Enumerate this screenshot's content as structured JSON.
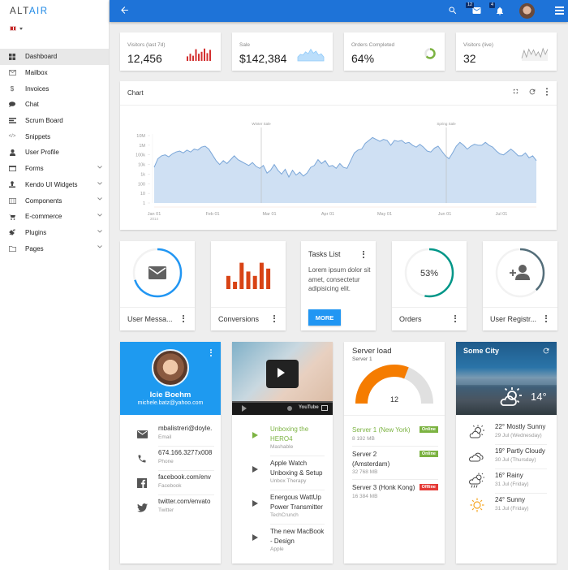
{
  "app": {
    "logo_dark": "ALT",
    "logo_accent": "AIR",
    "language": "en-gb"
  },
  "sidebar": {
    "items": [
      {
        "label": "Dashboard",
        "icon": "dashboard-icon",
        "active": true,
        "expandable": false
      },
      {
        "label": "Mailbox",
        "icon": "mail-icon",
        "active": false,
        "expandable": false
      },
      {
        "label": "Invoices",
        "icon": "dollar-icon",
        "active": false,
        "expandable": false
      },
      {
        "label": "Chat",
        "icon": "chat-icon",
        "active": false,
        "expandable": false
      },
      {
        "label": "Scrum Board",
        "icon": "board-icon",
        "active": false,
        "expandable": false
      },
      {
        "label": "Snippets",
        "icon": "code-icon",
        "active": false,
        "expandable": false
      },
      {
        "label": "User Profile",
        "icon": "user-icon",
        "active": false,
        "expandable": false
      },
      {
        "label": "Forms",
        "icon": "form-icon",
        "active": false,
        "expandable": true
      },
      {
        "label": "Kendo UI Widgets",
        "icon": "kendo-icon",
        "active": false,
        "expandable": true
      },
      {
        "label": "Components",
        "icon": "components-icon",
        "active": false,
        "expandable": true
      },
      {
        "label": "E-commerce",
        "icon": "cart-icon",
        "active": false,
        "expandable": true
      },
      {
        "label": "Plugins",
        "icon": "plug-icon",
        "active": false,
        "expandable": true
      },
      {
        "label": "Pages",
        "icon": "folder-icon",
        "active": false,
        "expandable": true
      }
    ]
  },
  "topbar": {
    "back_icon": "arrow-left-icon",
    "mail_count": "12",
    "notification_count": "4"
  },
  "stats": [
    {
      "label": "Visitors (last 7d)",
      "value": "12,456",
      "sparkline": "bar",
      "color": "#d32f2f",
      "bars": [
        0.35,
        0.55,
        0.4,
        0.9,
        0.55,
        0.7,
        0.95,
        0.6,
        0.85
      ]
    },
    {
      "label": "Sale",
      "value": "$142,384",
      "sparkline": "area",
      "color": "#90caf9",
      "points": [
        0.3,
        0.5,
        0.45,
        0.7,
        0.55,
        0.9,
        0.6,
        0.75,
        0.45,
        0.55,
        0.3
      ]
    },
    {
      "label": "Orders Completed",
      "value": "64%",
      "sparkline": "donut",
      "color": "#7cb342",
      "percent": 64
    },
    {
      "label": "Visitors (live)",
      "value": "32",
      "sparkline": "line",
      "color": "#9e9e9e",
      "points": [
        0.2,
        0.8,
        0.3,
        0.9,
        0.5,
        0.85,
        0.4,
        0.7,
        0.3,
        0.95,
        0.5,
        0.9
      ]
    }
  ],
  "chart_card": {
    "title": "Chart"
  },
  "chart_data": {
    "type": "area",
    "title": "Chart",
    "xlabel": "",
    "ylabel": "",
    "y_scale": "log",
    "y_ticks": [
      "1",
      "10",
      "100",
      "1k",
      "10k",
      "100k",
      "1M",
      "10M"
    ],
    "x_ticks": [
      "Jan 01",
      "Feb 01",
      "Mar 01",
      "Apr 01",
      "May 01",
      "Jun 01",
      "Jul 01"
    ],
    "x_year_label": "2014",
    "annotations": [
      {
        "label": "Winter Sale",
        "x": "Feb 27"
      },
      {
        "label": "Spring Sale",
        "x": "Jun 01"
      }
    ],
    "series": [
      {
        "name": "Visitors",
        "color": "#7aa6d8",
        "fill": "#cfe0f3",
        "log10_values": [
          3.7,
          4.6,
          4.9,
          5.0,
          4.8,
          5.1,
          5.3,
          5.4,
          5.2,
          5.5,
          5.3,
          5.6,
          5.5,
          5.8,
          5.9,
          5.6,
          5.0,
          4.4,
          4.0,
          4.4,
          4.1,
          4.5,
          4.9,
          4.5,
          4.3,
          4.1,
          3.9,
          4.2,
          3.8,
          3.6,
          3.9,
          3.1,
          3.4,
          4.0,
          3.4,
          3.0,
          3.5,
          2.7,
          3.4,
          2.9,
          3.2,
          2.8,
          3.1,
          3.7,
          3.9,
          4.5,
          4.1,
          4.4,
          3.8,
          3.9,
          3.6,
          4.1,
          3.7,
          3.6,
          4.4,
          5.2,
          5.5,
          5.6,
          6.2,
          6.5,
          6.8,
          6.6,
          6.4,
          6.6,
          6.5,
          6.0,
          6.5,
          6.4,
          6.5,
          6.2,
          6.3,
          6.0,
          5.8,
          6.1,
          5.8,
          5.4,
          5.3,
          5.7,
          5.9,
          5.4,
          4.9,
          4.6,
          5.2,
          5.9,
          6.3,
          6.0,
          5.6,
          5.9,
          6.1,
          6.0,
          6.0,
          6.3,
          6.0,
          5.8,
          5.4,
          5.1,
          5.0,
          5.3,
          5.6,
          5.3,
          4.9,
          4.9,
          5.2,
          4.7,
          4.9,
          4.4
        ]
      }
    ]
  },
  "mini_cards": [
    {
      "label": "User Messa...",
      "kind": "progress-icon",
      "icon": "mail-icon",
      "color": "#2196f3",
      "percent": 70
    },
    {
      "label": "Conversions",
      "kind": "bars",
      "color": "#d84315",
      "bars": [
        0.45,
        0.25,
        0.9,
        0.6,
        0.45,
        0.9,
        0.7
      ]
    },
    {
      "label": "Orders",
      "kind": "progress-text",
      "value_text": "53%",
      "color": "#009688",
      "percent": 53
    },
    {
      "label": "User Registr...",
      "kind": "progress-icon",
      "icon": "add-user-icon",
      "color": "#546e7a",
      "percent": 38
    }
  ],
  "tasks": {
    "title": "Tasks List",
    "body": "Lorem ipsum dolor sit amet, consectetur adipisicing elit.",
    "button": "MORE"
  },
  "profile": {
    "name": "Icie Boehm",
    "email": "michele.batz@yahoo.com",
    "contacts": [
      {
        "icon": "mail-icon",
        "value": "mbalistreri@doyle.",
        "label": "Email"
      },
      {
        "icon": "phone-icon",
        "value": "674.166.3277x008",
        "label": "Phone"
      },
      {
        "icon": "facebook-icon",
        "value": "facebook.com/env",
        "label": "Facebook"
      },
      {
        "icon": "twitter-icon",
        "value": "twitter.com/envato",
        "label": "Twitter"
      }
    ]
  },
  "videos": {
    "player_brand": "YouTube",
    "items": [
      {
        "title": "Unboxing the HERO4",
        "source": "Mashable",
        "active": true
      },
      {
        "title": "Apple Watch Unboxing & Setup",
        "source": "Unbox Therapy",
        "active": false
      },
      {
        "title": "Energous WattUp Power Transmitter",
        "source": "TechCrunch",
        "active": false
      },
      {
        "title": "The new MacBook - Design",
        "source": "Apple",
        "active": false
      }
    ]
  },
  "server": {
    "title": "Server load",
    "subtitle": "Server 1",
    "gauge_value": "12",
    "gauge_fraction": 0.62,
    "gauge_color": "#f57c00",
    "servers": [
      {
        "name": "Server 1 (New York)",
        "size": "8 192 MB",
        "status": "Online",
        "status_color": "#7cb342",
        "highlight": true
      },
      {
        "name": "Server 2 (Amsterdam)",
        "size": "32 768 MB",
        "status": "Online",
        "status_color": "#7cb342",
        "highlight": false
      },
      {
        "name": "Server 3 (Honk Kong)",
        "size": "16 384 MB",
        "status": "Offline",
        "status_color": "#e53935",
        "highlight": false
      }
    ]
  },
  "weather": {
    "city": "Some City",
    "current_temp": "14°",
    "forecast": [
      {
        "icon": "partly-sunny-icon",
        "text": "22° Mostly Sunny",
        "date": "29 Jul (Wednesday)"
      },
      {
        "icon": "cloudy-icon",
        "text": "19° Partly Cloudy",
        "date": "30 Jul (Thursday)"
      },
      {
        "icon": "rainy-icon",
        "text": "16° Rainy",
        "date": "31 Jul (Friday)"
      },
      {
        "icon": "sunny-icon",
        "text": "24° Sunny",
        "date": "31 Jul (Friday)"
      }
    ]
  },
  "colors": {
    "primary": "#1e73d8",
    "accent": "#2196f3",
    "green": "#7cb342"
  }
}
